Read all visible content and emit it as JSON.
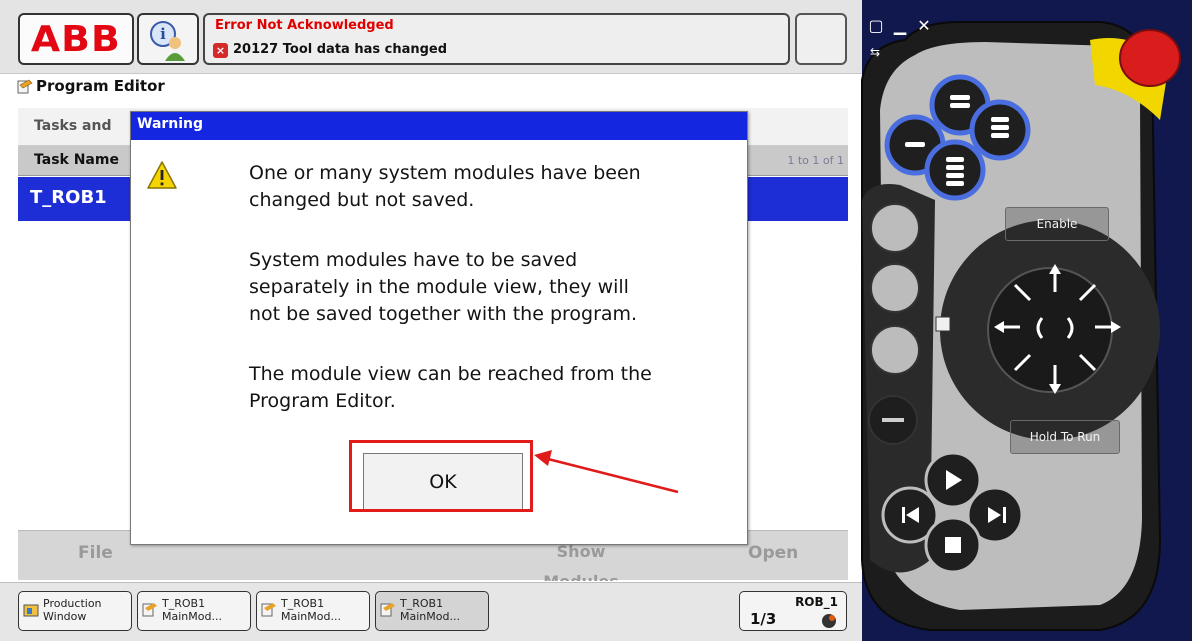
{
  "topbar": {
    "logo_text": "ABB",
    "event": {
      "title": "Error Not Acknowledged",
      "message": "20127 Tool data has changed"
    }
  },
  "view": {
    "title": "Program Editor",
    "tasks_header": "Tasks and",
    "table": {
      "column_task_name": "Task Name",
      "page_count": "1 to 1 of 1",
      "selected_row": "T_ROB1"
    }
  },
  "dialog": {
    "title": "Warning",
    "paragraphs": [
      "One or many system modules have been\nchanged but not saved.",
      "System modules have to be saved\nseparately in the module view, they will\nnot be saved together with the program.",
      "The module view can be reached from the\nProgram Editor."
    ],
    "ok_label": "OK"
  },
  "command_bar": {
    "file": "File",
    "show_modules": "Show\nModules",
    "open": "Open"
  },
  "taskbar": {
    "items": [
      {
        "line1": "Production",
        "line2": "Window"
      },
      {
        "line1": "T_ROB1",
        "line2": "MainMod..."
      },
      {
        "line1": "T_ROB1",
        "line2": "MainMod..."
      },
      {
        "line1": "T_ROB1",
        "line2": "MainMod..."
      }
    ],
    "robot": {
      "label": "ROB_1",
      "quickset": "1/3"
    }
  },
  "device": {
    "enable_label": "Enable",
    "hold_to_run_label": "Hold To Run",
    "window_controls": [
      "restore-icon",
      "minimize-icon",
      "close-icon",
      "swap-icon"
    ]
  },
  "colors": {
    "abb_red": "#e30613",
    "selection_blue": "#1e2ed6",
    "dialog_title_blue": "#1426e0",
    "annotation_red": "#e11a1a",
    "device_body": "#1a1a1a",
    "device_yellow": "#f2d600",
    "device_blue_buttons": "#4a6ee0"
  }
}
